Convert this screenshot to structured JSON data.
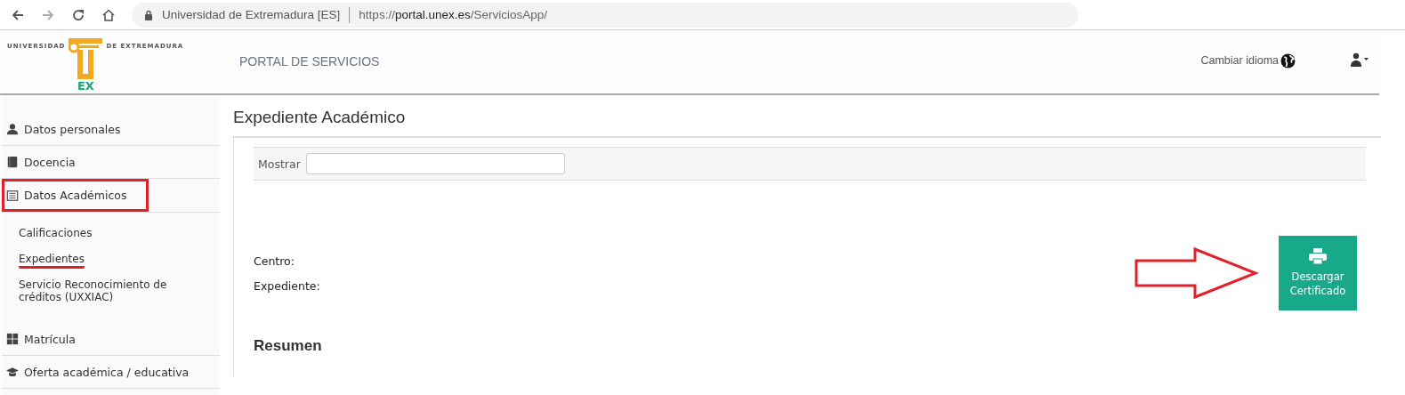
{
  "browser": {
    "forward_disabled": true,
    "site_name": "Universidad de Extremadura [ES]",
    "url_scheme": "https://",
    "url_host": "portal.unex.es",
    "url_path": "/ServiciosApp/"
  },
  "header": {
    "logo_left": "UNIVERSIDAD",
    "logo_right": "DE EXTREMADURA",
    "logo_bottom": "EX",
    "title": "PORTAL DE SERVICIOS",
    "language_link": "Cambiar idioma"
  },
  "sidebar": {
    "items": [
      {
        "label": "Datos personales",
        "highlighted": false
      },
      {
        "label": "Docencia",
        "highlighted": false
      },
      {
        "label": "Datos Académicos",
        "highlighted": true,
        "children": [
          {
            "label": "Calificaciones",
            "underlined": false
          },
          {
            "label": "Expedientes",
            "underlined": true
          },
          {
            "label": "Servicio Reconocimiento de créditos (UXXIAC)",
            "underlined": false
          }
        ]
      },
      {
        "label": "Matrícula",
        "highlighted": false
      },
      {
        "label": "Oferta académica / educativa",
        "highlighted": false
      }
    ]
  },
  "main": {
    "title": "Expediente Académico",
    "filter": {
      "label": "Mostrar"
    },
    "fields": [
      {
        "label": "Centro:"
      },
      {
        "label": "Expediente:"
      }
    ],
    "download_button": {
      "label": "Descargar Certificado",
      "pointed_by_arrow": true
    },
    "section_title": "Resumen"
  }
}
